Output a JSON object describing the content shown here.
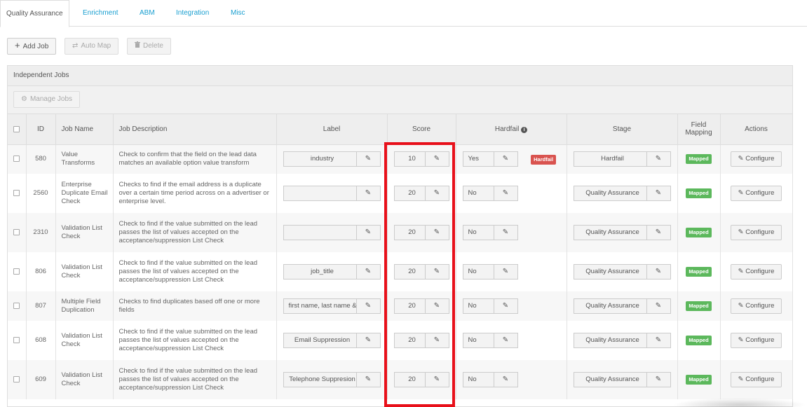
{
  "tabs": [
    {
      "label": "Quality Assurance",
      "active": true
    },
    {
      "label": "Enrichment",
      "active": false
    },
    {
      "label": "ABM",
      "active": false
    },
    {
      "label": "Integration",
      "active": false
    },
    {
      "label": "Misc",
      "active": false
    }
  ],
  "toolbar": {
    "add_job": "Add Job",
    "auto_map": "Auto Map",
    "delete": "Delete"
  },
  "section": {
    "title": "Independent Jobs",
    "manage_jobs": "Manage Jobs"
  },
  "columns": {
    "id": "ID",
    "job_name": "Job Name",
    "job_description": "Job Description",
    "label": "Label",
    "score": "Score",
    "hardfail": "Hardfail",
    "stage": "Stage",
    "field_mapping": "Field Mapping",
    "actions": "Actions"
  },
  "rows": [
    {
      "id": "580",
      "name": "Value Transforms",
      "description": "Check to confirm that the field on the lead data matches an available option value transform",
      "label": "industry",
      "score": "10",
      "hardfail": "Yes",
      "hardfail_badge": "Hardfail",
      "stage": "Hardfail",
      "mapping": "Mapped",
      "action": "Configure"
    },
    {
      "id": "2560",
      "name": "Enterprise Duplicate Email Check",
      "description": "Checks to find if the email address is a duplicate over a certain time period across on a advertiser or enterprise level.",
      "label": "",
      "score": "20",
      "hardfail": "No",
      "hardfail_badge": "",
      "stage": "Quality Assurance",
      "mapping": "Mapped",
      "action": "Configure"
    },
    {
      "id": "2310",
      "name": "Validation List Check",
      "description": "Check to find if the value submitted on the lead passes the list of values accepted on the acceptance/suppression List Check",
      "label": "",
      "score": "20",
      "hardfail": "No",
      "hardfail_badge": "",
      "stage": "Quality Assurance",
      "mapping": "Mapped",
      "action": "Configure"
    },
    {
      "id": "806",
      "name": "Validation List Check",
      "description": "Check to find if the value submitted on the lead passes the list of values accepted on the acceptance/suppression List Check",
      "label": "job_title",
      "score": "20",
      "hardfail": "No",
      "hardfail_badge": "",
      "stage": "Quality Assurance",
      "mapping": "Mapped",
      "action": "Configure"
    },
    {
      "id": "807",
      "name": "Multiple Field Duplication",
      "description": "Checks to find duplicates based off one or more fields",
      "label": "first name, last name &",
      "score": "20",
      "hardfail": "No",
      "hardfail_badge": "",
      "stage": "Quality Assurance",
      "mapping": "Mapped",
      "action": "Configure"
    },
    {
      "id": "608",
      "name": "Validation List Check",
      "description": "Check to find if the value submitted on the lead passes the list of values accepted on the acceptance/suppression List Check",
      "label": "Email Suppression",
      "score": "20",
      "hardfail": "No",
      "hardfail_badge": "",
      "stage": "Quality Assurance",
      "mapping": "Mapped",
      "action": "Configure"
    },
    {
      "id": "609",
      "name": "Validation List Check",
      "description": "Check to find if the value submitted on the lead passes the list of values accepted on the acceptance/suppression List Check",
      "label": "Telephone Suppresion",
      "score": "20",
      "hardfail": "No",
      "hardfail_badge": "",
      "stage": "Quality Assurance",
      "mapping": "Mapped",
      "action": "Configure"
    }
  ],
  "icons": {
    "plus": "plus-icon",
    "auto_map": "shuffle-icon",
    "delete": "trash-icon",
    "gear": "gear-icon",
    "edit": "pencil-icon",
    "info": "info-icon"
  },
  "colors": {
    "tab_link": "#1a9fd0",
    "mapped": "#5cb85c",
    "hardfail": "#d9534f",
    "highlight": "#e8101a"
  }
}
